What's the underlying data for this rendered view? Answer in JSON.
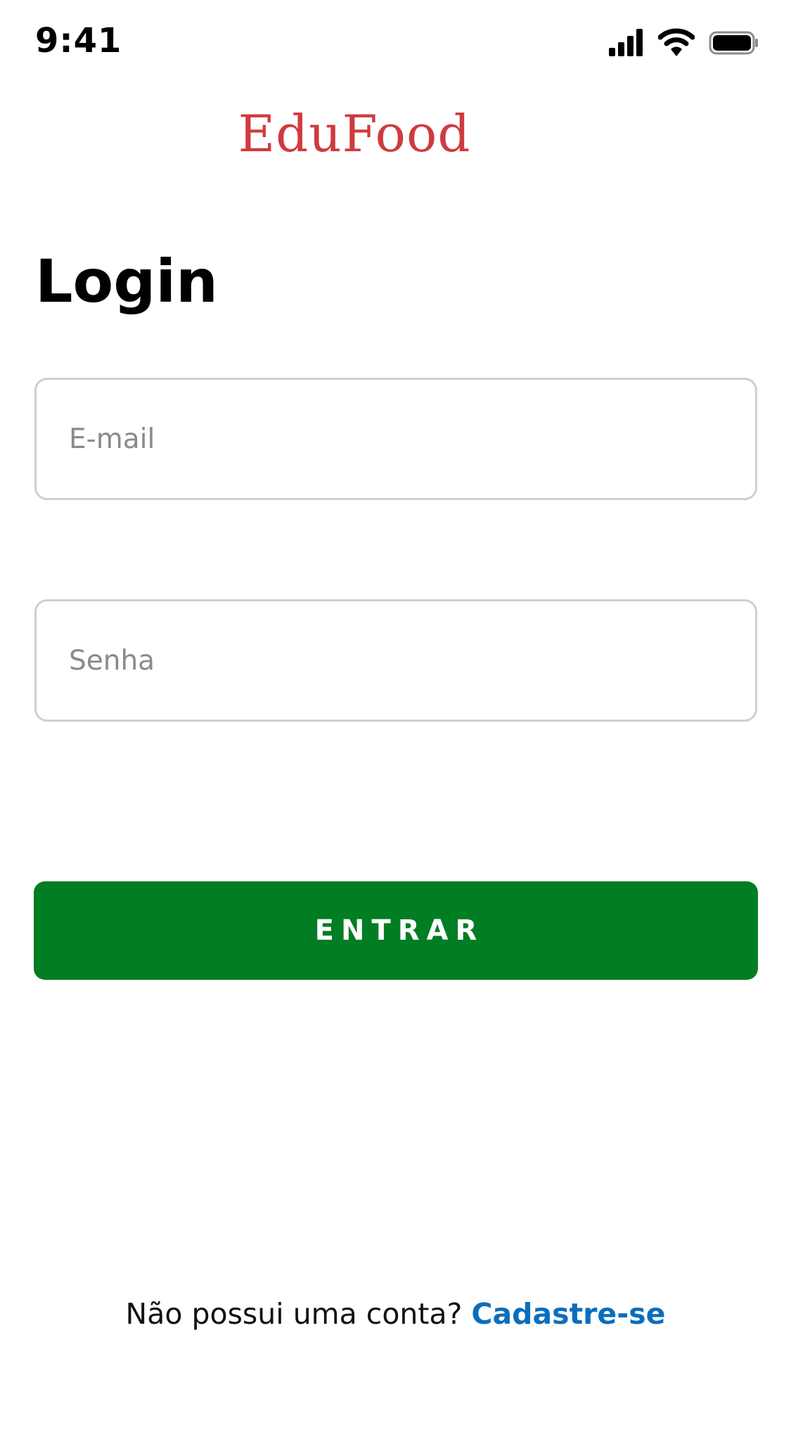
{
  "status_bar": {
    "time": "9:41",
    "icons": [
      "cellular-signal-icon",
      "wifi-icon",
      "battery-icon"
    ]
  },
  "app": {
    "name": "EduFood",
    "brand_color": "#cf3b3f"
  },
  "login": {
    "title": "Login",
    "email": {
      "placeholder": "E-mail",
      "value": ""
    },
    "password": {
      "placeholder": "Senha",
      "value": ""
    },
    "submit_label": "ENTRAR",
    "submit_color": "#017d23"
  },
  "signup": {
    "prompt": "Não possui uma conta?",
    "link_label": "Cadastre-se",
    "link_color": "#0a6ebd"
  }
}
